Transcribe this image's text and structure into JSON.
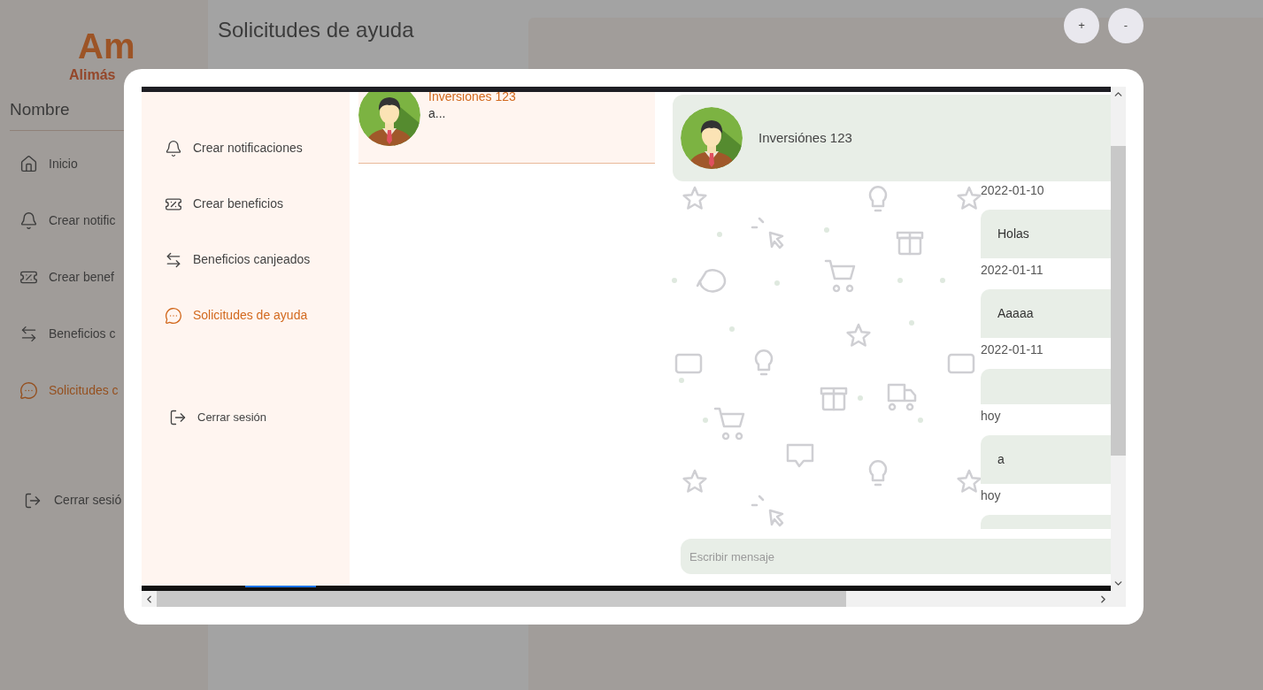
{
  "page": {
    "logo": {
      "mark": "Am",
      "name": "Alimás"
    },
    "user_name": "Nombre",
    "title": "Solicitudes de ayuda",
    "sidebar": {
      "items": [
        {
          "kind": "home",
          "label": "Inicio",
          "selected": false
        },
        {
          "kind": "bell",
          "label": "Crear notific",
          "selected": false
        },
        {
          "kind": "ticket",
          "label": "Crear benef",
          "selected": false
        },
        {
          "kind": "swap",
          "label": "Beneficios c",
          "selected": false
        },
        {
          "kind": "chat",
          "label": "Solicitudes c",
          "selected": true
        }
      ],
      "logout": "Cerrar sesió"
    },
    "zoom_buttons": [
      "+",
      "-"
    ]
  },
  "modal": {
    "sidebar": {
      "items": [
        {
          "kind": "bell",
          "label": "Crear notificaciones",
          "selected": false
        },
        {
          "kind": "ticket",
          "label": "Crear beneficios",
          "selected": false
        },
        {
          "kind": "swap",
          "label": "Beneficios canjeados",
          "selected": false
        },
        {
          "kind": "chat",
          "label": "Solicitudes de ayuda",
          "selected": true
        }
      ],
      "logout": "Cerrar sesión"
    },
    "conversations": [
      {
        "name": "Inversiones 123",
        "preview": "a..."
      }
    ],
    "chat": {
      "contact": "Inversiónes 123",
      "messages": [
        {
          "date": "2022-01-10",
          "text": "Holas"
        },
        {
          "date": "2022-01-11",
          "text": "Aaaaa"
        },
        {
          "date": "2022-01-11"
        },
        {
          "date": "hoy",
          "text": "a"
        },
        {
          "date": "hoy"
        }
      ],
      "input": {
        "placeholder": "Escribir mensaje"
      }
    }
  }
}
